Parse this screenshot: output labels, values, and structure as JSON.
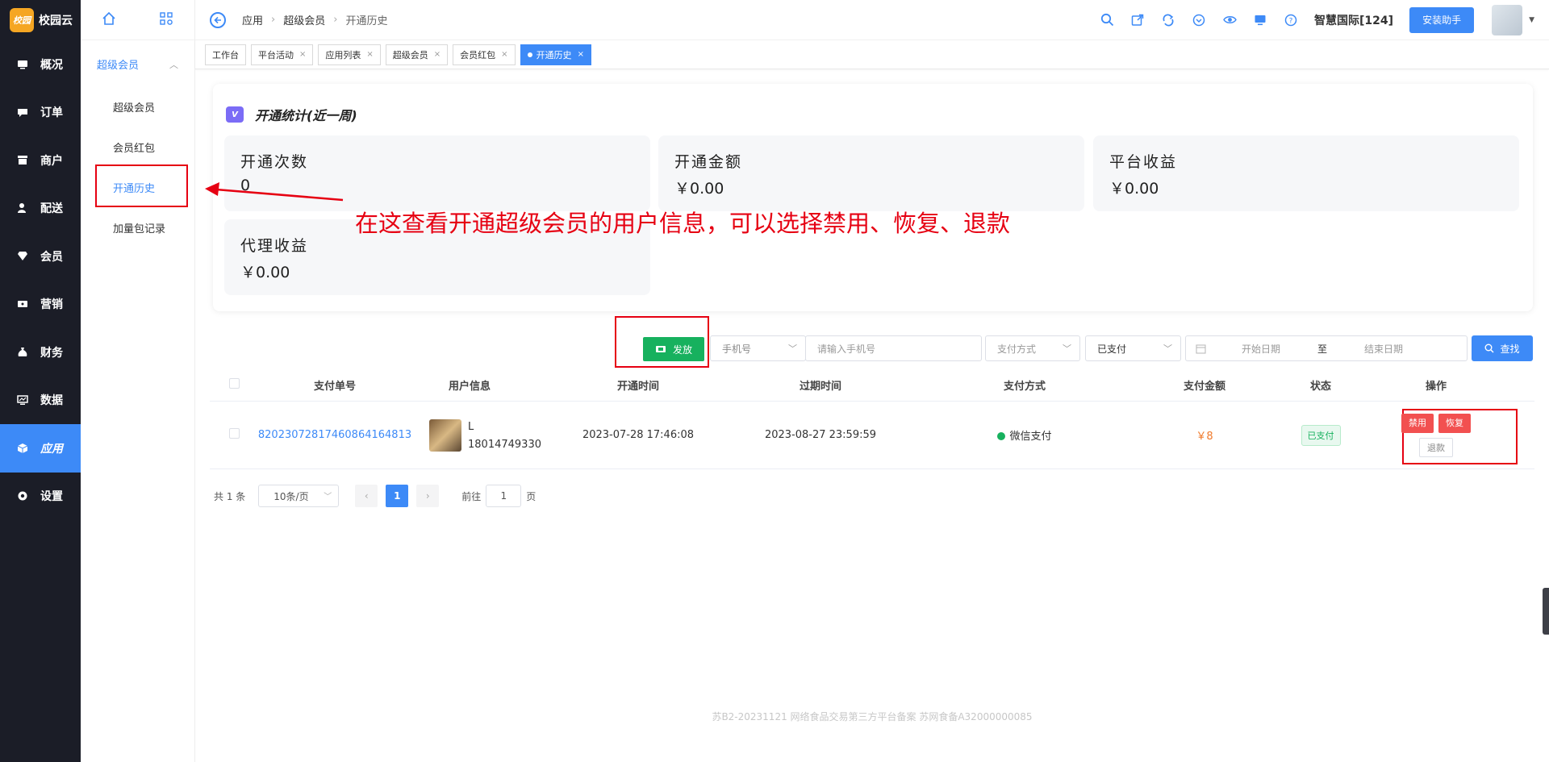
{
  "app": {
    "logo_mark": "校园",
    "logo_text": "校园云"
  },
  "leftnav": [
    {
      "label": "概况",
      "icon": "overview-icon",
      "active": false
    },
    {
      "label": "订单",
      "icon": "order-icon",
      "active": false
    },
    {
      "label": "商户",
      "icon": "store-icon",
      "active": false
    },
    {
      "label": "配送",
      "icon": "delivery-icon",
      "active": false
    },
    {
      "label": "会员",
      "icon": "diamond-icon",
      "active": false
    },
    {
      "label": "营销",
      "icon": "ticket-icon",
      "active": false
    },
    {
      "label": "财务",
      "icon": "money-bag-icon",
      "active": false
    },
    {
      "label": "数据",
      "icon": "monitor-icon",
      "active": false
    },
    {
      "label": "应用",
      "icon": "cube-icon",
      "active": true
    },
    {
      "label": "设置",
      "icon": "settings-icon",
      "active": false
    }
  ],
  "subnav": {
    "group": "超级会员",
    "items": [
      {
        "label": "超级会员",
        "active": false
      },
      {
        "label": "会员红包",
        "active": false
      },
      {
        "label": "开通历史",
        "active": true
      },
      {
        "label": "加量包记录",
        "active": false
      }
    ]
  },
  "topbar": {
    "crumbs": [
      "应用",
      "超级会员",
      "开通历史"
    ],
    "org_name": "智慧国际[124]",
    "install_label": "安装助手"
  },
  "tabs": [
    {
      "label": "工作台",
      "closable": false,
      "active": false
    },
    {
      "label": "平台活动",
      "closable": true,
      "active": false
    },
    {
      "label": "应用列表",
      "closable": true,
      "active": false
    },
    {
      "label": "超级会员",
      "closable": true,
      "active": false
    },
    {
      "label": "会员红包",
      "closable": true,
      "active": false
    },
    {
      "label": "开通历史",
      "closable": true,
      "active": true
    }
  ],
  "stats": {
    "badge": "V",
    "title": "开通统计(近一周)",
    "open_count_label": "开通次数",
    "open_count_value": "0",
    "open_amount_label": "开通金额",
    "open_amount_value": "￥0.00",
    "platform_income_label": "平台收益",
    "platform_income_value": "￥0.00",
    "agent_income_label": "代理收益",
    "agent_income_value": "￥0.00"
  },
  "annotation": {
    "text": "在这查看开通超级会员的用户信息，可以选择禁用、恢复、退款"
  },
  "filters": {
    "issue_label": "发放",
    "phone_type": "手机号",
    "phone_placeholder": "请输入手机号",
    "pay_method_placeholder": "支付方式",
    "pay_status": "已支付",
    "start_date": "开始日期",
    "date_sep": "至",
    "end_date": "结束日期",
    "search_label": "查找"
  },
  "table": {
    "headers": [
      "支付单号",
      "用户信息",
      "开通时间",
      "过期时间",
      "支付方式",
      "支付金额",
      "状态",
      "操作"
    ],
    "rows": [
      {
        "order_no": "8202307281746086416481­3",
        "user_name": "L",
        "user_phone": "18014749330",
        "open_time": "2023-07-28 17:46:08",
        "expire_time": "2023-08-27 23:59:59",
        "pay_method": "微信支付",
        "amount": "￥8",
        "status": "已支付",
        "ops": [
          "禁用",
          "恢复",
          "退款"
        ]
      }
    ]
  },
  "pager": {
    "total": "共 1 条",
    "page_size": "10条/页",
    "current": "1",
    "goto_prefix": "前往",
    "goto_value": "1",
    "goto_suffix": "页"
  },
  "footer": "苏B2-20231121  网络食品交易第三方平台备案 苏网食备A32000000085"
}
